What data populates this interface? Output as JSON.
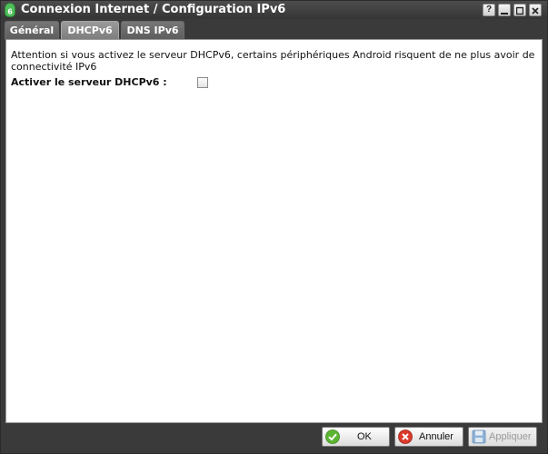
{
  "window": {
    "title": "Connexion Internet / Configuration IPv6",
    "controls": {
      "help": "?"
    }
  },
  "tabs": [
    {
      "label": "Général",
      "active": false
    },
    {
      "label": "DHCPv6",
      "active": true
    },
    {
      "label": "DNS IPv6",
      "active": false
    }
  ],
  "content": {
    "warning": "Attention si vous activez le serveur DHCPv6, certains périphériques Android risquent de ne plus avoir de connectivité IPv6",
    "dhcp_label": "Activer le serveur DHCPv6 :",
    "dhcp_checked": false
  },
  "footer": {
    "ok": "OK",
    "cancel": "Annuler",
    "apply": "Appliquer"
  },
  "colors": {
    "ok_icon": "#5cb531",
    "cancel_icon": "#d93a2b",
    "apply_icon": "#8fb3d9",
    "app_icon": "#4fbf5a"
  }
}
